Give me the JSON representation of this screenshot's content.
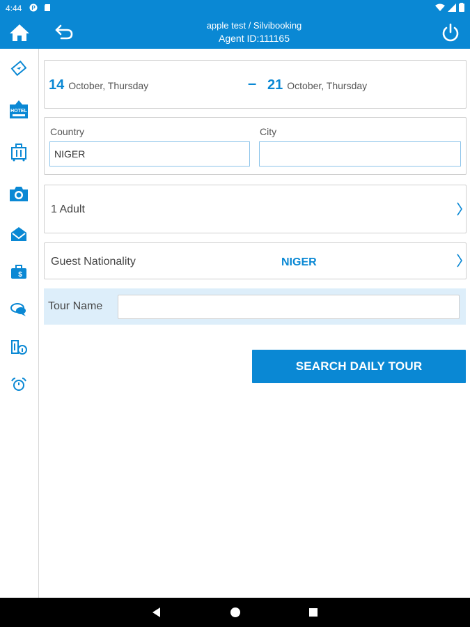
{
  "status_bar": {
    "time": "4:44"
  },
  "header": {
    "title": "apple test / Silvibooking",
    "agent_id": "Agent ID:111165"
  },
  "rail": {
    "icons": [
      "flight-ticket-icon",
      "hotel-icon",
      "luggage-icon",
      "camera-icon",
      "mail-icon",
      "briefcase-icon",
      "chat-icon",
      "building-info-icon",
      "alarm-icon"
    ]
  },
  "dates": {
    "start_day": "14",
    "start_text": "October, Thursday",
    "separator": "–",
    "end_day": "21",
    "end_text": "October, Thursday"
  },
  "location": {
    "country_label": "Country",
    "country_value": "NIGER",
    "city_label": "City",
    "city_value": ""
  },
  "guests": {
    "label": "1 Adult"
  },
  "nationality": {
    "label": "Guest Nationality",
    "value": "NIGER"
  },
  "tour": {
    "label": "Tour Name",
    "value": ""
  },
  "actions": {
    "search_label": "SEARCH DAILY TOUR"
  },
  "colors": {
    "accent": "#0a88d4",
    "tour_bg": "#ddeefa"
  }
}
